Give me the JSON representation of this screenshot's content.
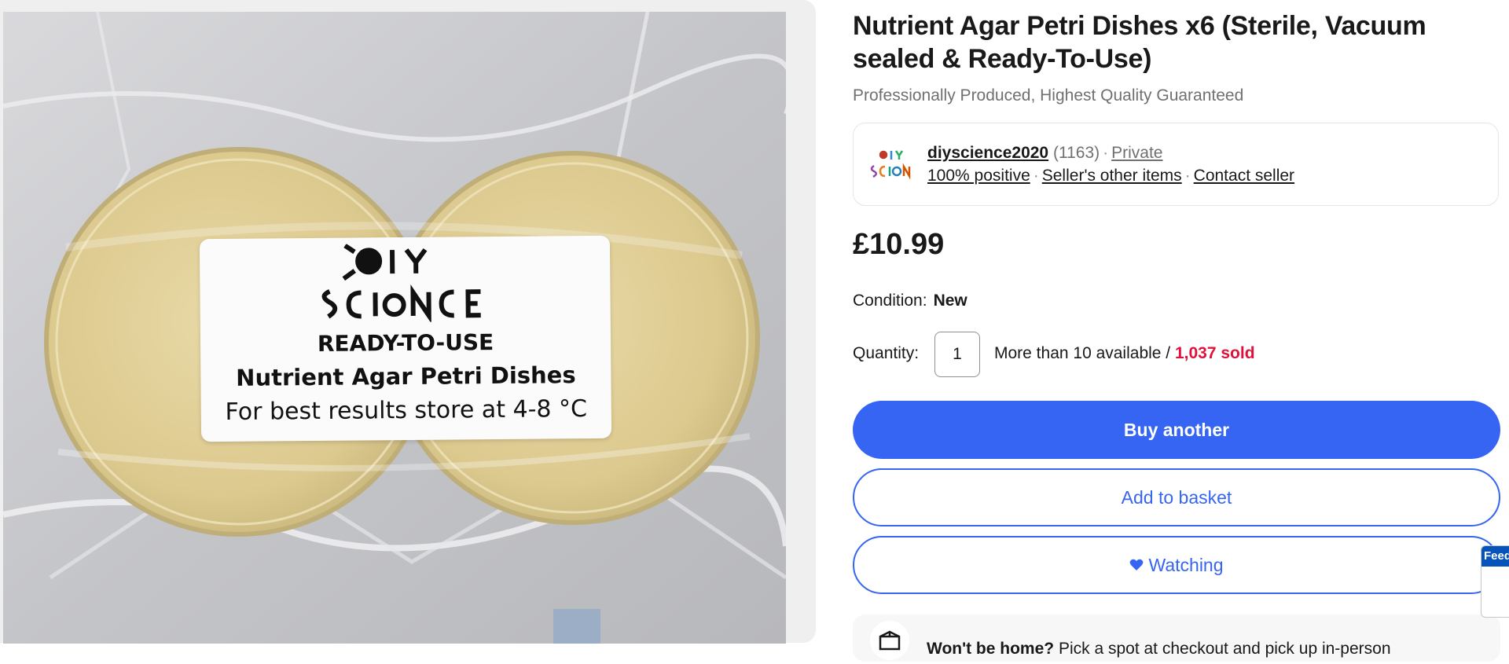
{
  "listing": {
    "title": "Nutrient Agar Petri Dishes x6 (Sterile, Vacuum sealed & Ready-To-Use)",
    "subtitle": "Professionally Produced, Highest Quality Guaranteed"
  },
  "image": {
    "label_line1": "READY-TO-USE",
    "label_line2": "Nutrient Agar Petri Dishes",
    "label_line3": "For best results store at 4-8 °C",
    "logo_text": "DIY SCIENCE"
  },
  "seller": {
    "name": "diyscience2020",
    "feedback_count": "(1163)",
    "type": "Private",
    "positive": "100% positive",
    "other_items": "Seller's other items",
    "contact": "Contact seller"
  },
  "price": "£10.99",
  "condition": {
    "label": "Condition:",
    "value": "New"
  },
  "quantity": {
    "label": "Quantity:",
    "value": "1",
    "availability": "More than 10 available /",
    "sold": "1,037 sold"
  },
  "buttons": {
    "buy": "Buy another",
    "basket": "Add to basket",
    "watch": "Watching"
  },
  "delivery": {
    "bold": "Won't be home?",
    "text": "Pick a spot at checkout and pick up in-person"
  },
  "feedback_tab": "Feedback",
  "colors": {
    "accent": "#3665f3",
    "sold": "#e0103a"
  },
  "icons": [
    "heart-icon",
    "package-icon",
    "seller-logo"
  ]
}
